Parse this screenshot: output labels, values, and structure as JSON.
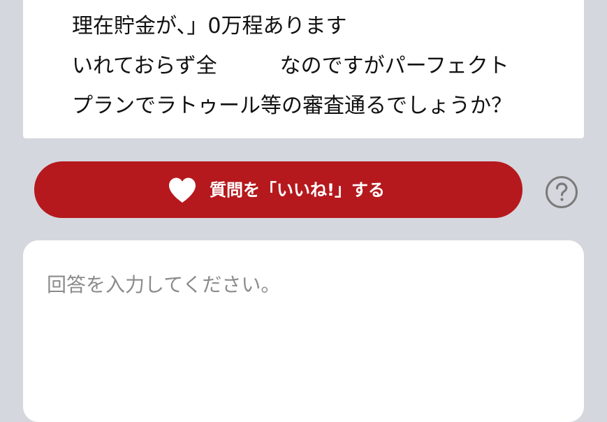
{
  "question": {
    "lines": [
      "理在貯金が、」0万程あります",
      "いれておらず全　　　なのですがパーフェクト",
      "プランでラトゥール等の審査通るでしょうか？"
    ]
  },
  "like_button": {
    "label": "質問を「いいね!」する",
    "icon": "heart-icon",
    "color": "#b5191d"
  },
  "help": {
    "icon": "question-circle-icon"
  },
  "answer": {
    "placeholder": "回答を入力してください。",
    "value": ""
  }
}
